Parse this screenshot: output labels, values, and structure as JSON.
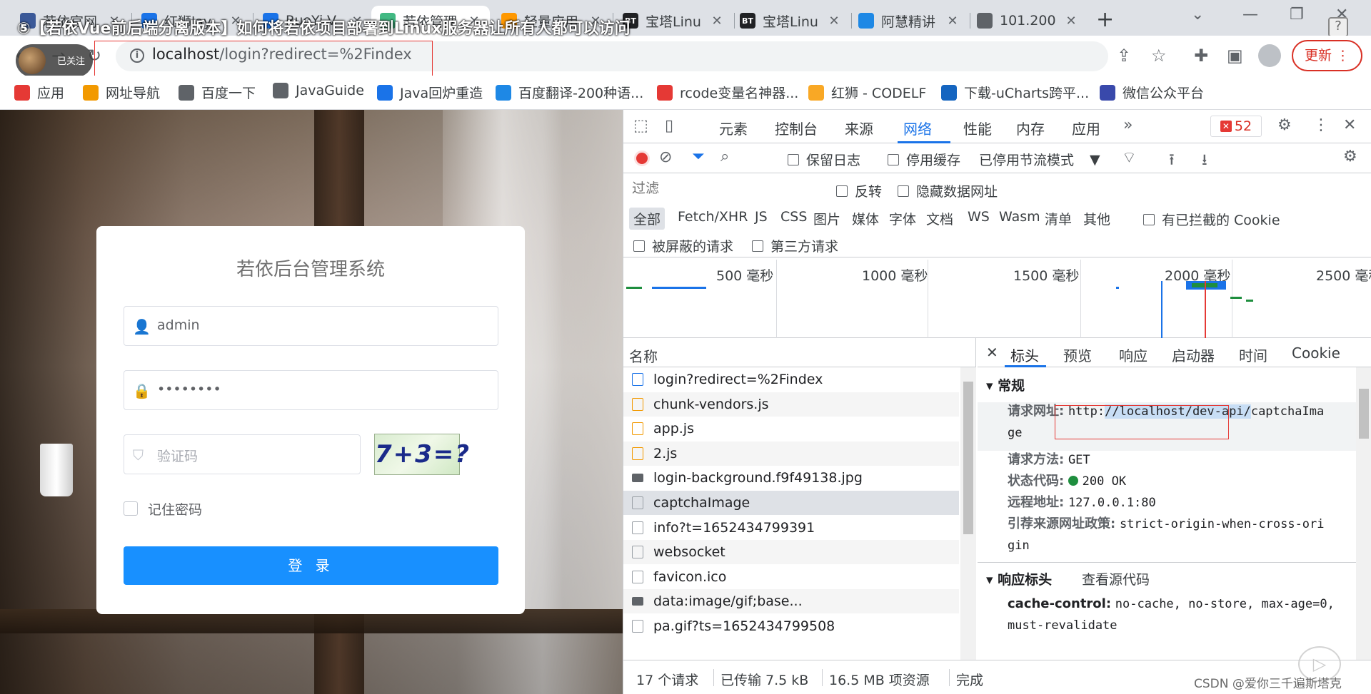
{
  "overlay_title": "⑤【若依Vue前后端分离版本】如何将若依项目部署到Linux服务器让所有人都可以访问",
  "tabs": [
    {
      "label": "若依官网",
      "fav_color": "#3b5998",
      "fav_text": "",
      "active": false
    },
    {
      "label": "红狮lay",
      "fav_color": "#1a73e8",
      "fav_text": "",
      "active": false
    },
    {
      "label": "RuoYi-V",
      "fav_color": "#1a73e8",
      "fav_text": "",
      "active": false
    },
    {
      "label": "若依管理",
      "fav_color": "#42b983",
      "fav_text": "",
      "active": true
    },
    {
      "label": "轻量应用",
      "fav_color": "#ff9800",
      "fav_text": "",
      "active": false
    },
    {
      "label": "宝塔Linu",
      "fav_color": "#202124",
      "fav_text": "BT",
      "active": false
    },
    {
      "label": "宝塔Linu",
      "fav_color": "#202124",
      "fav_text": "BT",
      "active": false
    },
    {
      "label": "阿慧精讲",
      "fav_color": "#1e88e5",
      "fav_text": "",
      "active": false
    },
    {
      "label": "101.200",
      "fav_color": "#5f6368",
      "fav_text": "",
      "active": false
    }
  ],
  "toolbar": {
    "follow_label": "已关注",
    "url_host": "localhost",
    "url_path": "/login?redirect=%2Findex",
    "update_label": "更新"
  },
  "bookmarks": [
    {
      "label": "应用",
      "icon_color": "#e53935"
    },
    {
      "label": "网址导航",
      "icon_color": "#f29900"
    },
    {
      "label": "百度一下",
      "icon_color": "#5f6368"
    },
    {
      "label": "JavaGuide",
      "icon_color": "#5f6368"
    },
    {
      "label": "Java回炉重造",
      "icon_color": "#1a73e8"
    },
    {
      "label": "百度翻译-200种语...",
      "icon_color": "#1e88e5"
    },
    {
      "label": "rcode变量名神器...",
      "icon_color": "#e53935"
    },
    {
      "label": "红狮 - CODELF",
      "icon_color": "#f9a825"
    },
    {
      "label": "下载-uCharts跨平...",
      "icon_color": "#1565c0"
    },
    {
      "label": "微信公众平台",
      "icon_color": "#3949ab"
    }
  ],
  "login": {
    "title": "若依后台管理系统",
    "username": "admin",
    "password_mask": "••••••••",
    "captcha_placeholder": "验证码",
    "captcha_text": "7+3=?",
    "remember_label": "记住密码",
    "login_button": "登 录"
  },
  "devtools": {
    "tabs": [
      "元素",
      "控制台",
      "来源",
      "网络",
      "性能",
      "内存",
      "应用"
    ],
    "error_count": "52",
    "preserve_log": "保留日志",
    "disable_cache": "停用缓存",
    "throttle": "已停用节流模式",
    "filter_placeholder": "过滤",
    "invert": "反转",
    "hide_data_urls": "隐藏数据网址",
    "types": [
      "全部",
      "Fetch/XHR",
      "JS",
      "CSS",
      "图片",
      "媒体",
      "字体",
      "文档",
      "WS",
      "Wasm",
      "清单",
      "其他"
    ],
    "blocked_cookies": "有已拦截的 Cookie",
    "blocked_requests": "被屏蔽的请求",
    "third_party": "第三方请求",
    "timeline_labels": [
      "500 毫秒",
      "1000 毫秒",
      "1500 毫秒",
      "2000 毫秒",
      "2500 毫秒"
    ],
    "name_header": "名称",
    "requests": [
      {
        "name": "login?redirect=%2Findex",
        "kind": "doc"
      },
      {
        "name": "chunk-vendors.js",
        "kind": "js"
      },
      {
        "name": "app.js",
        "kind": "js"
      },
      {
        "name": "2.js",
        "kind": "js"
      },
      {
        "name": "login-background.f9f49138.jpg",
        "kind": "img"
      },
      {
        "name": "captchaImage",
        "kind": "other"
      },
      {
        "name": "info?t=1652434799391",
        "kind": "other"
      },
      {
        "name": "websocket",
        "kind": "other"
      },
      {
        "name": "favicon.ico",
        "kind": "other"
      },
      {
        "name": "data:image/gif;base...",
        "kind": "img"
      },
      {
        "name": "pa.gif?ts=1652434799508",
        "kind": "other"
      }
    ],
    "detail_tabs": [
      "标头",
      "预览",
      "响应",
      "启动器",
      "时间",
      "Cookie"
    ],
    "general_title": "常规",
    "general": {
      "request_url_label": "请求网址:",
      "request_url_pre": "http:",
      "request_url_hl": "//localhost/dev-api/",
      "request_url_post": "captchaIma",
      "request_url_wrap": "ge",
      "method_label": "请求方法:",
      "method": "GET",
      "status_label": "状态代码:",
      "status": "200 OK",
      "remote_label": "远程地址:",
      "remote": "127.0.0.1:80",
      "referrer_label": "引荐来源网址政策:",
      "referrer": "strict-origin-when-cross-ori",
      "referrer_wrap": "gin"
    },
    "response_headers_title": "响应标头",
    "view_source": "查看源代码",
    "cache_control_label": "cache-control:",
    "cache_control": "no-cache, no-store, max-age=0,",
    "cache_control_wrap": "must-revalidate",
    "status_bar": [
      "17 个请求",
      "已传输 7.5 kB",
      "16.5 MB 项资源",
      "完成"
    ]
  },
  "watermark": "CSDN @爱你三千遍斯塔克"
}
